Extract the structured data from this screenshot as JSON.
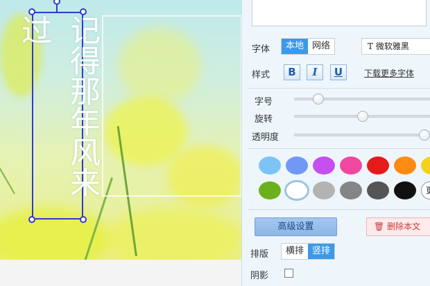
{
  "canvas": {
    "vertical_text": "记得那年风来过"
  },
  "panel": {
    "font_label": "字体",
    "font_source_tabs": [
      {
        "label": "本地",
        "active": true
      },
      {
        "label": "网络",
        "active": false
      }
    ],
    "font_name": "T 微软雅黑",
    "style_label": "样式",
    "style_buttons": {
      "bold": "B",
      "italic": "I",
      "underline": "U"
    },
    "download_more_fonts": "下载更多字体",
    "size_label": "字号",
    "rotate_label": "旋转",
    "opacity_label": "透明度",
    "sliders": {
      "size": 0.18,
      "rotate": 0.5,
      "opacity": 1.0
    },
    "colors": [
      "#7cc4f6",
      "#6f99f3",
      "#c54ff0",
      "#f0479f",
      "#e51b1b",
      "#fd8a12",
      "#f3d21c",
      "#6cb11d",
      "#ffffff",
      "#b3b3b3",
      "#858585",
      "#555555",
      "#111111"
    ],
    "selected_color": "#ffffff",
    "more_colors_label": "更",
    "advanced_button": "高级设置",
    "delete_button": "删除本文",
    "delete_icon": "trash-icon",
    "layout_label": "排版",
    "layout_tabs": [
      {
        "label": "横排",
        "active": false
      },
      {
        "label": "竖排",
        "active": true
      }
    ],
    "shadow_label": "阴影",
    "shadow_checked": false
  }
}
